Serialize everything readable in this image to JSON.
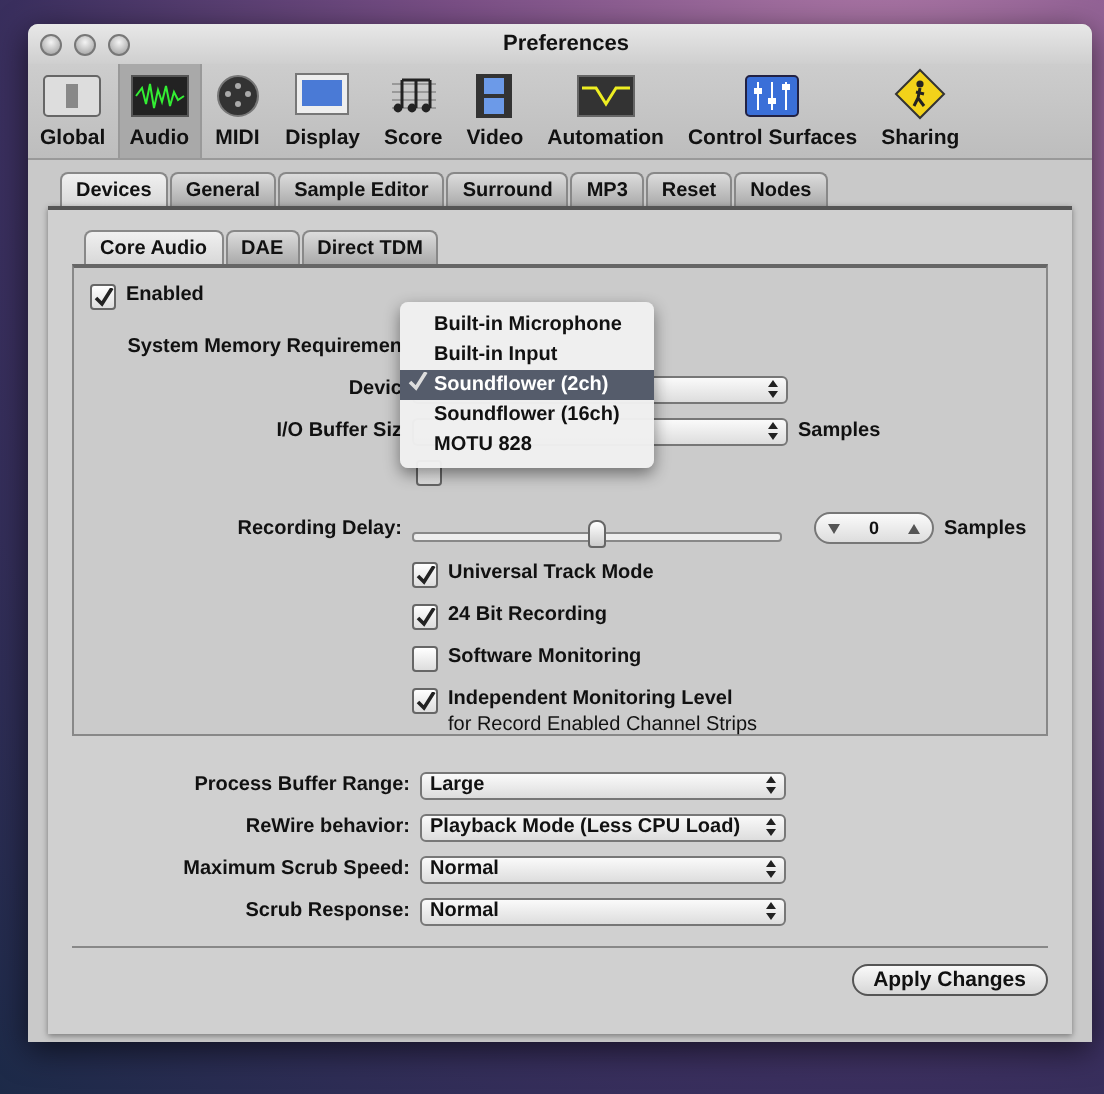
{
  "window": {
    "title": "Preferences"
  },
  "toolbar": [
    {
      "label": "Global",
      "selected": false
    },
    {
      "label": "Audio",
      "selected": true
    },
    {
      "label": "MIDI",
      "selected": false
    },
    {
      "label": "Display",
      "selected": false
    },
    {
      "label": "Score",
      "selected": false
    },
    {
      "label": "Video",
      "selected": false
    },
    {
      "label": "Automation",
      "selected": false
    },
    {
      "label": "Control Surfaces",
      "selected": false
    },
    {
      "label": "Sharing",
      "selected": false
    }
  ],
  "tabs": [
    {
      "label": "Devices",
      "selected": true
    },
    {
      "label": "General",
      "selected": false
    },
    {
      "label": "Sample Editor",
      "selected": false
    },
    {
      "label": "Surround",
      "selected": false
    },
    {
      "label": "MP3",
      "selected": false
    },
    {
      "label": "Reset",
      "selected": false
    },
    {
      "label": "Nodes",
      "selected": false
    }
  ],
  "subtabs": [
    {
      "label": "Core Audio",
      "selected": true
    },
    {
      "label": "DAE",
      "selected": false
    },
    {
      "label": "Direct TDM",
      "selected": false
    }
  ],
  "enabled": {
    "label": "Enabled",
    "checked": true
  },
  "system_memory": {
    "label": "System Memory Requiremen"
  },
  "device": {
    "label": "Devic"
  },
  "io_buffer": {
    "label": "I/O Buffer Siz",
    "unit": "Samples"
  },
  "safety_buffer": {
    "checked": false
  },
  "recording_delay": {
    "label": "Recording Delay:",
    "level": 0.5,
    "value": "0",
    "unit": "Samples"
  },
  "options": [
    {
      "label": "Universal Track Mode",
      "checked": true
    },
    {
      "label": "24 Bit Recording",
      "checked": true
    },
    {
      "label": "Software Monitoring",
      "checked": false
    },
    {
      "label": "Independent Monitoring Level",
      "note": "for Record Enabled Channel Strips",
      "checked": true
    }
  ],
  "device_menu": [
    {
      "label": "Built-in Microphone",
      "selected": false
    },
    {
      "label": "Built-in Input",
      "selected": false
    },
    {
      "label": "Soundflower (2ch)",
      "selected": true
    },
    {
      "label": "Soundflower (16ch)",
      "selected": false
    },
    {
      "label": "MOTU 828",
      "selected": false
    }
  ],
  "settings": [
    {
      "label": "Process Buffer Range:",
      "value": "Large"
    },
    {
      "label": "ReWire behavior:",
      "value": "Playback Mode (Less CPU Load)"
    },
    {
      "label": "Maximum Scrub Speed:",
      "value": "Normal"
    },
    {
      "label": "Scrub Response:",
      "value": "Normal"
    }
  ],
  "apply_button": "Apply Changes"
}
